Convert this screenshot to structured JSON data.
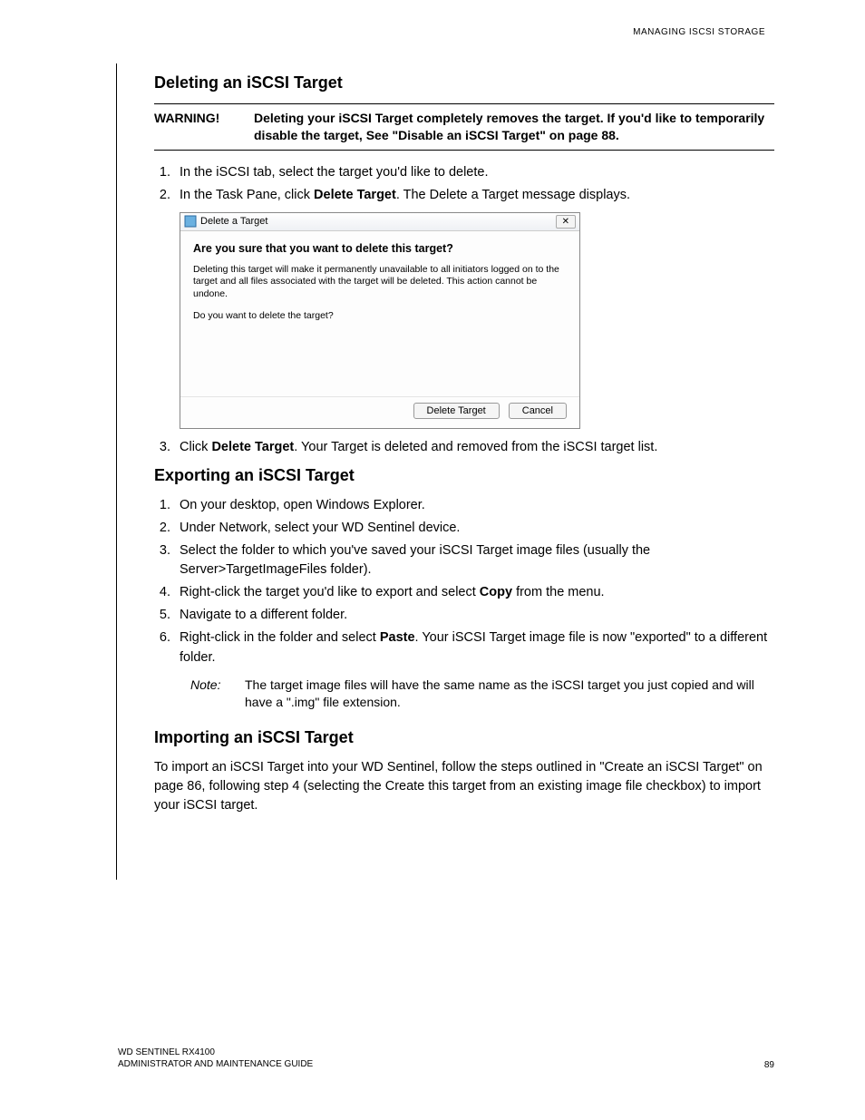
{
  "header": {
    "right": "MANAGING ISCSI STORAGE"
  },
  "section1": {
    "title": "Deleting an iSCSI Target",
    "warning_label": "WARNING!",
    "warning_text": "Deleting your iSCSI Target completely removes the target. If you'd like to temporarily disable the target, See \"Disable an iSCSI Target\" on page 88.",
    "step1": "In the iSCSI tab, select the target you'd like to delete.",
    "step2_pre": "In the Task Pane, click ",
    "step2_bold": "Delete Target",
    "step2_post": ". The Delete a Target message displays.",
    "step3_pre": "Click ",
    "step3_bold": "Delete Target",
    "step3_post": ". Your Target is deleted and removed from the iSCSI target list."
  },
  "dialog": {
    "title": "Delete a Target",
    "heading": "Are you sure that you want to delete this target?",
    "body1": "Deleting this target will make it permanently unavailable to all initiators logged on to the target and all files associated with the target will be deleted.  This action cannot be undone.",
    "body2": "Do you want to delete the target?",
    "btn_delete": "Delete Target",
    "btn_cancel": "Cancel",
    "close_glyph": "✕"
  },
  "section2": {
    "title": "Exporting an iSCSI Target",
    "step1": "On your desktop, open Windows Explorer.",
    "step2": "Under Network, select your WD Sentinel device.",
    "step3": "Select the folder to which you've saved your iSCSI Target image files (usually the Server>TargetImageFiles folder).",
    "step4_pre": "Right-click the target you'd like to export and select ",
    "step4_bold": "Copy",
    "step4_post": " from the menu.",
    "step5": "Navigate to a different folder.",
    "step6_pre": "Right-click in the folder and select ",
    "step6_bold": "Paste",
    "step6_post": ". Your iSCSI Target image file is now \"exported\" to a different folder.",
    "note_label": "Note:",
    "note_text": "The target image files will have the same name as the iSCSI target you just copied and will have a \".img\" file extension."
  },
  "section3": {
    "title": "Importing an iSCSI Target",
    "para": "To import an iSCSI Target into your WD Sentinel, follow the steps outlined in \"Create an iSCSI Target\" on page 86, following step 4 (selecting the Create this target from an existing image file checkbox) to import your iSCSI target."
  },
  "footer": {
    "product": "WD SENTINEL RX4100",
    "guide": "ADMINISTRATOR AND MAINTENANCE GUIDE",
    "page": "89"
  }
}
